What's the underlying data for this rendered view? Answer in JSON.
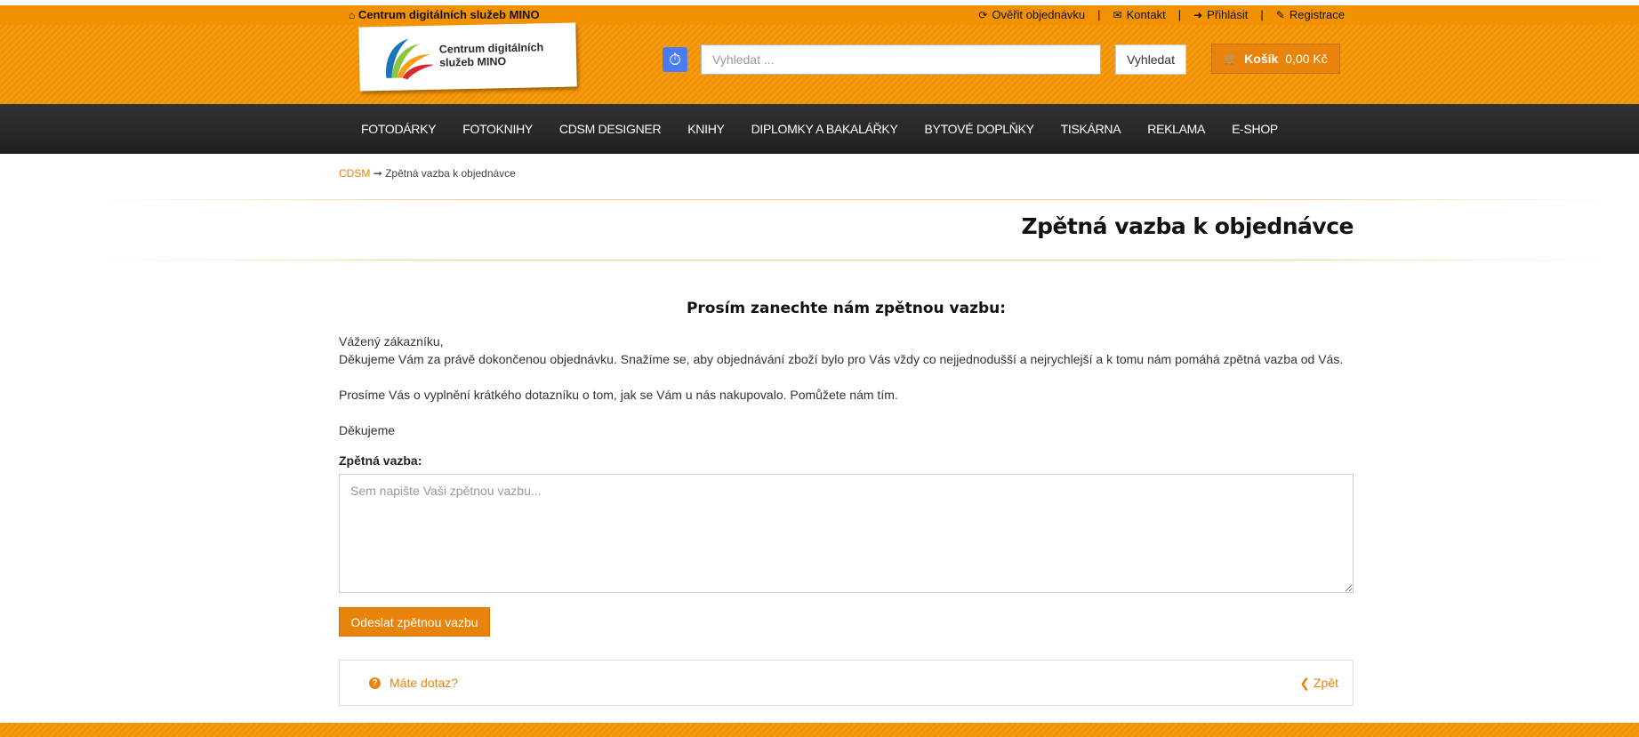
{
  "topbar": {
    "brand": "Centrum digitálních služeb MINO",
    "links": [
      {
        "label": "Ověřit objednávku",
        "icon": "refresh-icon"
      },
      {
        "label": "Kontakt",
        "icon": "envelope-icon"
      },
      {
        "label": "Přihlásit",
        "icon": "sign-in-icon"
      },
      {
        "label": "Registrace",
        "icon": "pencil-icon"
      }
    ],
    "separator": "|"
  },
  "header": {
    "logo_line1": "Centrum digitálních",
    "logo_line2": "služeb MINO",
    "search_placeholder": "Vyhledat ...",
    "search_button": "Vyhledat",
    "cart_label": "Košík",
    "cart_value": "0,00 Kč"
  },
  "nav": {
    "items": [
      "FOTODÁRKY",
      "FOTOKNIHY",
      "CDSM DESIGNER",
      "KNIHY",
      "DIPLOMKY A BAKALÁŘKY",
      "BYTOVÉ DOPLŇKY",
      "TISKÁRNA",
      "REKLAMA",
      "E-SHOP"
    ]
  },
  "breadcrumb": {
    "home": "CDSM",
    "arrow": "➞",
    "current": "Zpětná vazba k objednávce"
  },
  "main": {
    "title": "Zpětná vazba k objednávce",
    "subtitle": "Prosím zanechte nám zpětnou vazbu:",
    "greeting": "Vážený zákazníku,",
    "paragraph1": "Děkujeme Vám za právě dokončenou objednávku. Snažíme se, aby objednávání zboží bylo pro Vás vždy co nejjednodušší a nejrychlejší a k tomu nám pomáhá zpětná vazba od Vás.",
    "paragraph2": "Prosíme Vás o vyplnění krátkého dotazníku o tom, jak se Vám u nás nakupovalo. Pomůžete nám tím.",
    "thanks": "Děkujeme",
    "feedback_label": "Zpětná vazba:",
    "feedback_placeholder": "Sem napište Vaši zpětnou vazbu...",
    "submit_label": "Odeslat zpětnou vazbu"
  },
  "footer": {
    "question": "Máte dotaz?",
    "back": "Zpět"
  },
  "colors": {
    "accent": "#f39200",
    "button": "#e8830b",
    "nav_bg": "#2a2a2a"
  }
}
